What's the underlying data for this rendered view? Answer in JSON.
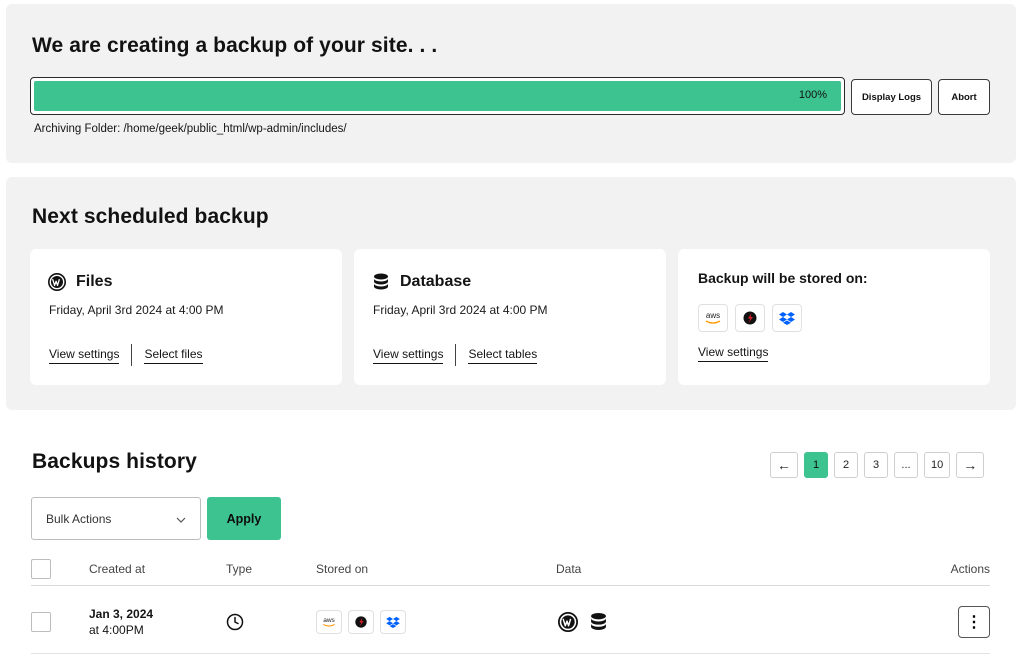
{
  "progress": {
    "title": "We are creating a backup of your site. . .",
    "percent": 100,
    "percent_label": "100%",
    "display_logs": "Display Logs",
    "abort": "Abort",
    "archiving_text": "Archiving Folder: /home/geek/public_html/wp-admin/includes/"
  },
  "schedule": {
    "title": "Next scheduled backup",
    "files": {
      "title": "Files",
      "date": "Friday, April 3rd 2024 at 4:00 PM",
      "link1": "View settings",
      "link2": "Select files",
      "icon": "wordpress-icon"
    },
    "database": {
      "title": "Database",
      "date": "Friday, April 3rd 2024 at 4:00 PM",
      "link1": "View settings",
      "link2": "Select tables",
      "icon": "database-icon"
    },
    "storage": {
      "title": "Backup will be stored on:",
      "link": "View settings",
      "aws_text": "aws",
      "icons": [
        "aws-icon",
        "backblaze-icon",
        "dropbox-icon"
      ]
    }
  },
  "history": {
    "title": "Backups history",
    "pagination": {
      "prev": "←",
      "pages": [
        "1",
        "2",
        "3",
        "...",
        "10"
      ],
      "active": "1",
      "next": "→"
    },
    "bulk_actions": "Bulk Actions",
    "apply": "Apply",
    "columns": {
      "created_at": "Created at",
      "type": "Type",
      "stored_on": "Stored on",
      "data": "Data",
      "actions": "Actions"
    },
    "rows": [
      {
        "date": "Jan 3, 2024",
        "time": "at 4:00PM",
        "type_icon": "clock-icon",
        "aws_text": "aws",
        "stored_icons": [
          "aws-icon",
          "backblaze-icon",
          "dropbox-icon"
        ],
        "data_icons": [
          "wordpress-icon",
          "database-icon"
        ],
        "actions": "⋮"
      }
    ]
  },
  "colors": {
    "accent": "#3cc390",
    "panel": "#f2f2f2",
    "dropbox": "#0061fe",
    "backblaze": "#e21e26",
    "aws_orange": "#ff9900"
  }
}
